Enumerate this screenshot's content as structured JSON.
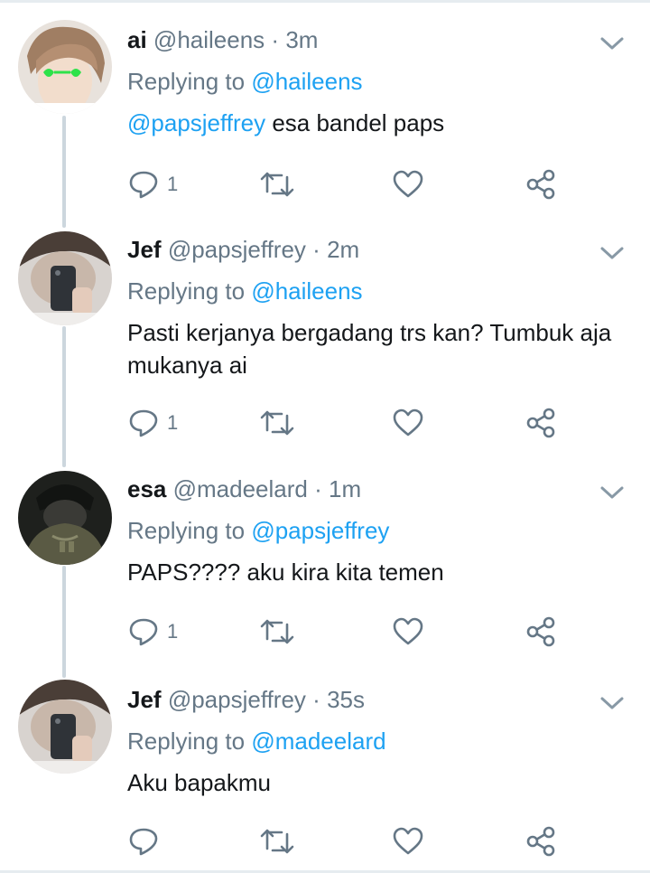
{
  "tweets": [
    {
      "name": "ai",
      "handle": "@haileens",
      "dot": "·",
      "time": "3m",
      "reply_prefix": "Replying to",
      "reply_handle": "@haileens",
      "mention": "@papsjeffrey",
      "text": " esa bandel paps",
      "reply_count": "1",
      "avatar": "avatar-green-heart-glasses"
    },
    {
      "name": "Jef",
      "handle": "@papsjeffrey",
      "dot": "·",
      "time": "2m",
      "reply_prefix": "Replying to",
      "reply_handle": "@haileens",
      "mention": "",
      "text": "Pasti kerjanya bergadang trs kan? Tumbuk aja mukanya ai",
      "reply_count": "1",
      "avatar": "avatar-phone-selfie"
    },
    {
      "name": "esa",
      "handle": "@madeelard",
      "dot": "·",
      "time": "1m",
      "reply_prefix": "Replying to",
      "reply_handle": "@papsjeffrey",
      "mention": "",
      "text": "PAPS???? aku kira kita temen",
      "reply_count": "1",
      "avatar": "avatar-dark-cap"
    },
    {
      "name": "Jef",
      "handle": "@papsjeffrey",
      "dot": "·",
      "time": "35s",
      "reply_prefix": "Replying to",
      "reply_handle": "@madeelard",
      "mention": "",
      "text": "Aku bapakmu",
      "reply_count": "",
      "avatar": "avatar-phone-selfie"
    }
  ],
  "icons": {
    "reply": "reply-icon",
    "retweet": "retweet-icon",
    "like": "heart-icon",
    "share": "share-icon",
    "menu": "chevron-down-icon"
  },
  "colors": {
    "link": "#1da1f2",
    "secondary_text": "#657786",
    "connector": "#ccd6dd"
  }
}
